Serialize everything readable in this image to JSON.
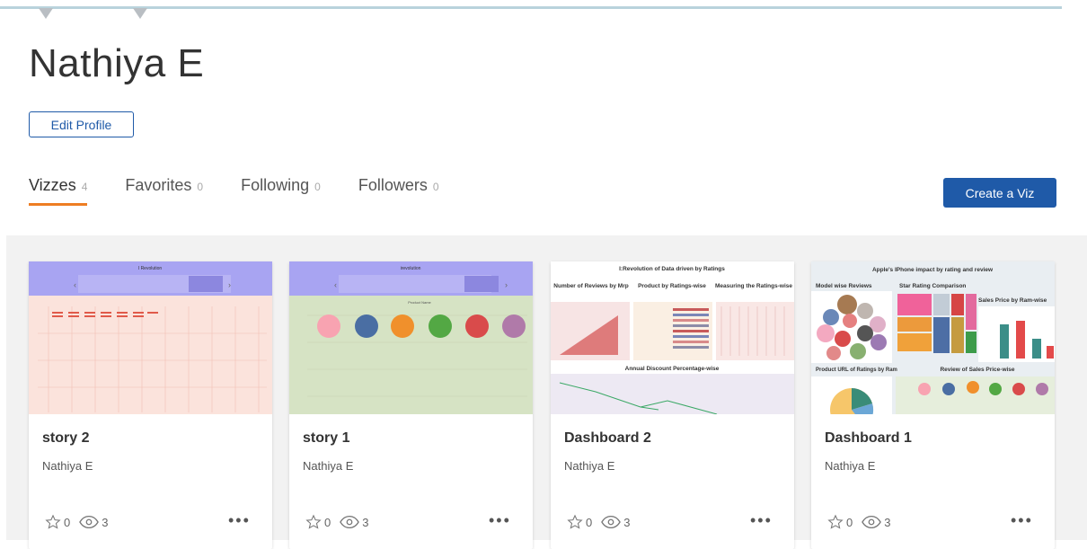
{
  "profile": {
    "name": "Nathiya E",
    "edit_label": "Edit Profile"
  },
  "tabs": [
    {
      "label": "Vizzes",
      "count": "4"
    },
    {
      "label": "Favorites",
      "count": "0"
    },
    {
      "label": "Following",
      "count": "0"
    },
    {
      "label": "Followers",
      "count": "0"
    }
  ],
  "create_label": "Create a Viz",
  "cards": [
    {
      "title": "story 2",
      "author": "Nathiya E",
      "favorites": "0",
      "views": "3",
      "thumb": {
        "header": "I Revolution"
      }
    },
    {
      "title": "story 1",
      "author": "Nathiya E",
      "favorites": "0",
      "views": "3",
      "thumb": {
        "header": "irevolution",
        "subheader": "Product Name"
      }
    },
    {
      "title": "Dashboard 2",
      "author": "Nathiya E",
      "favorites": "0",
      "views": "3",
      "thumb": {
        "header": "I:Revolution of Data driven by Ratings",
        "panel1": "Number of Reviews by Mrp",
        "panel2": "Product by Ratings-wise",
        "panel3": "Measuring the Ratings-wise",
        "bottom": "Annual Discount Percentage-wise"
      }
    },
    {
      "title": "Dashboard 1",
      "author": "Nathiya E",
      "favorites": "0",
      "views": "3",
      "thumb": {
        "header": "Apple's IPhone impact by rating and review",
        "panel1": "Model wise Reviews",
        "panel2": "Star Rating Comparison",
        "panel3": "Sales Price by Ram-wise",
        "panel4": "Product URL of Ratings by Ram",
        "panel5": "Review of Sales Price-wise"
      }
    }
  ],
  "colors": {
    "accent": "#ee7d23",
    "primary": "#1f5aa8"
  }
}
